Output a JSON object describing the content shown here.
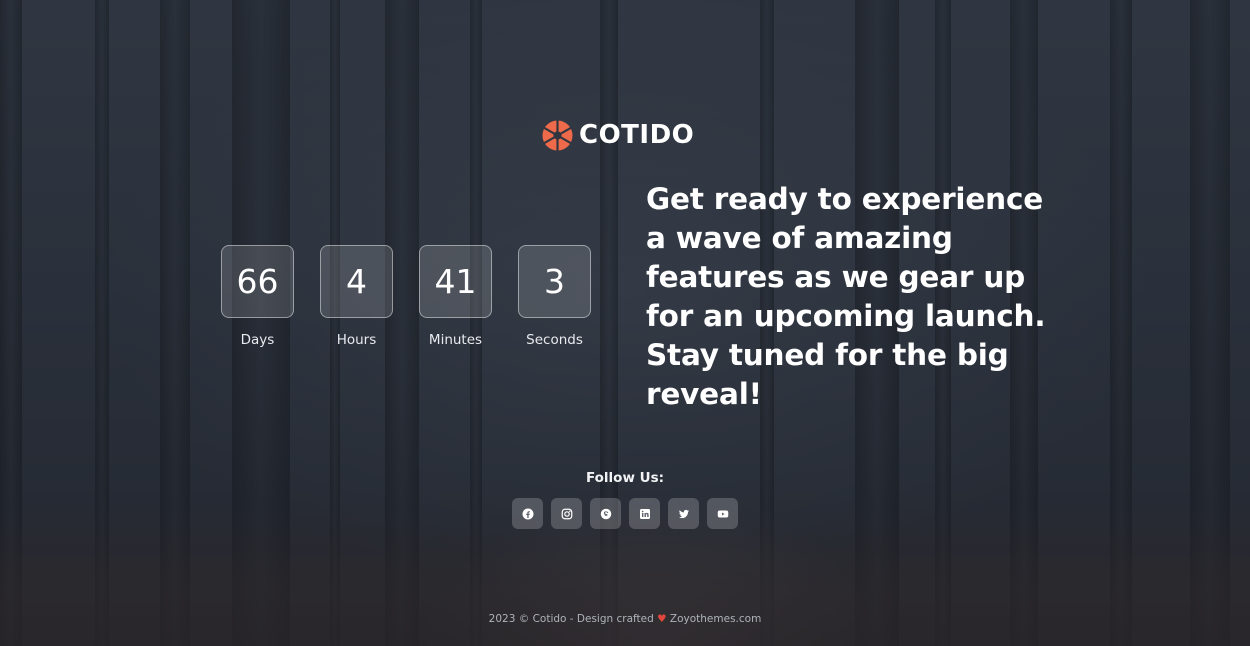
{
  "brand": {
    "name": "COTIDO",
    "accent": "#ee6a4a"
  },
  "countdown": [
    {
      "value": "66",
      "label": "Days"
    },
    {
      "value": "4",
      "label": "Hours"
    },
    {
      "value": "41",
      "label": "Minutes"
    },
    {
      "value": "3",
      "label": "Seconds"
    }
  ],
  "headline": "Get ready to experience a wave of amazing features as we gear up for an upcoming launch. Stay tuned for the big reveal!",
  "follow": {
    "title": "Follow Us:",
    "links": [
      {
        "icon": "facebook-icon"
      },
      {
        "icon": "instagram-icon"
      },
      {
        "icon": "skype-icon"
      },
      {
        "icon": "linkedin-icon"
      },
      {
        "icon": "twitter-icon"
      },
      {
        "icon": "youtube-icon"
      }
    ]
  },
  "footer": {
    "prefix": "2023 © Cotido - Design crafted",
    "heart": "♥",
    "suffix": "Zoyothemes.com"
  }
}
